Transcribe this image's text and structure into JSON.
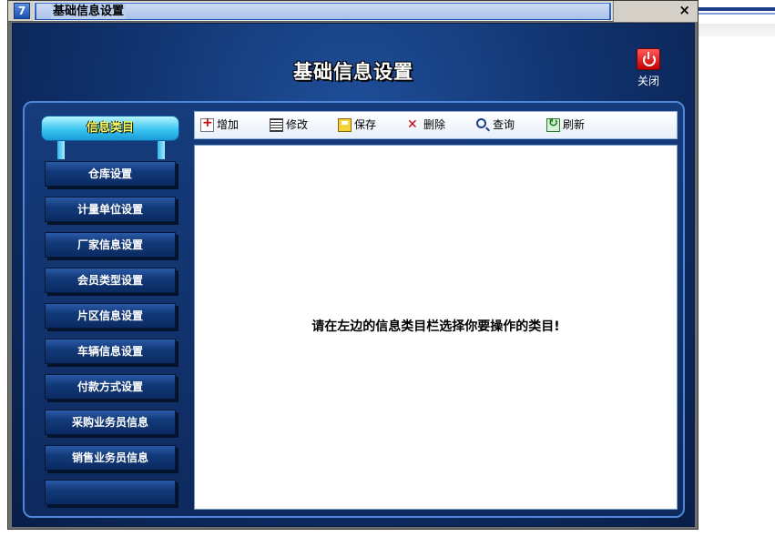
{
  "window": {
    "title": "基础信息设置",
    "app_icon": "7",
    "close_glyph": "×"
  },
  "header": {
    "title": "基础信息设置",
    "close_label": "关闭",
    "close_icon": "power-icon"
  },
  "sidebar": {
    "header": "信息类目",
    "items": [
      {
        "label": "仓库设置"
      },
      {
        "label": "计量单位设置"
      },
      {
        "label": "厂家信息设置"
      },
      {
        "label": "会员类型设置"
      },
      {
        "label": "片区信息设置"
      },
      {
        "label": "车辆信息设置"
      },
      {
        "label": "付款方式设置"
      },
      {
        "label": "采购业务员信息"
      },
      {
        "label": "销售业务员信息"
      },
      {
        "label": ""
      }
    ]
  },
  "toolbar": {
    "items": [
      {
        "label": "增加",
        "icon": "add-icon"
      },
      {
        "label": "修改",
        "icon": "edit-icon"
      },
      {
        "label": "保存",
        "icon": "save-icon"
      },
      {
        "label": "删除",
        "icon": "delete-icon"
      },
      {
        "label": "查询",
        "icon": "search-icon"
      },
      {
        "label": "刷新",
        "icon": "refresh-icon"
      }
    ]
  },
  "content": {
    "hint": "请在左边的信息类目栏选择你要操作的类目!"
  },
  "colors": {
    "panel_blue": "#0f2f68",
    "accent_cyan": "#39c6f2",
    "close_red": "#c40000"
  }
}
